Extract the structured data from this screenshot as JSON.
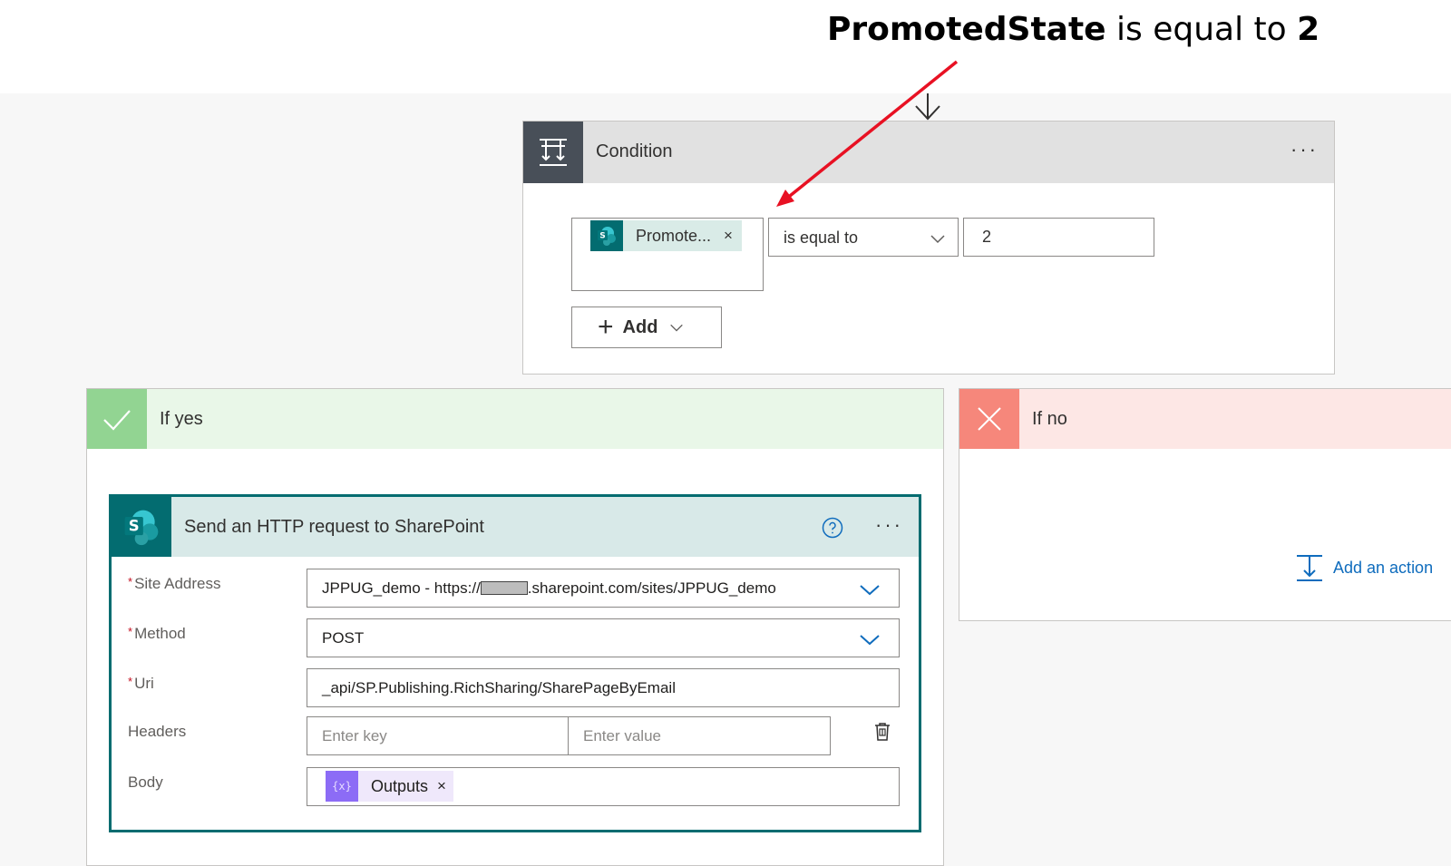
{
  "annotation": {
    "field": "PromotedState",
    "operator": " is equal to ",
    "value": "2"
  },
  "condition": {
    "title": "Condition",
    "more_label": "···",
    "token_label": "Promote...",
    "token_remove": "×",
    "operator": "is equal to",
    "value": "2",
    "add_label": "Add"
  },
  "if_yes": {
    "title": "If yes"
  },
  "if_no": {
    "title": "If no",
    "add_action_label": "Add an action"
  },
  "sharepoint_action": {
    "title": "Send an HTTP request to SharePoint",
    "more_label": "···",
    "required_mark": "*",
    "site_address": {
      "label": "Site Address",
      "value_prefix": "JPPUG_demo - https://",
      "value_suffix": ".sharepoint.com/sites/JPPUG_demo"
    },
    "method": {
      "label": "Method",
      "value": "POST"
    },
    "uri": {
      "label": "Uri",
      "value": "_api/SP.Publishing.RichSharing/SharePageByEmail"
    },
    "headers": {
      "label": "Headers",
      "key_placeholder": "Enter key",
      "value_placeholder": "Enter value"
    },
    "body": {
      "label": "Body",
      "token_label": "Outputs",
      "token_remove": "×",
      "token_icon_glyph": "{x}"
    }
  },
  "icons": {
    "condition": "condition-icon",
    "sharepoint": "sharepoint-icon",
    "check": "check-icon",
    "close": "close-icon",
    "help": "help-circle-icon",
    "trash": "trash-icon",
    "add_action": "add-action-icon",
    "chevron": "chevron-down-icon"
  },
  "colors": {
    "sharepoint_teal": "#036c70",
    "yes_green": "#92d492",
    "no_red": "#f6877b",
    "link_blue": "#0f6cbd",
    "annotation_arrow": "#e81123",
    "outputs_purple": "#8c6cf6"
  }
}
